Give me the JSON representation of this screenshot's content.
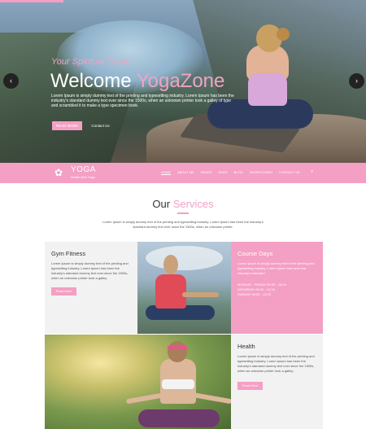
{
  "hero": {
    "subtitle": "Your Spiritual Guide",
    "title_prefix": "Welcome",
    "title_brand": "YogaZone",
    "description": "Lorem Ipsum is simply dummy text of the printing and typesetting industry. Lorem Ipsum has been the industry's standard dummy text ever since the 1500s, when an unknown printer took a galley of type and scrambled it to make a type specimen book.",
    "read_more": "READ MORE",
    "contact_us": "Contact Us",
    "prev_arrow": "‹",
    "next_arrow": "›"
  },
  "nav": {
    "logo_text": "YOGA",
    "logo_tagline": "Health And Yoga",
    "items": [
      "HOME",
      "ABOUT ME",
      "PAGES",
      "SHOP",
      "BLOG",
      "SHORTCODES",
      "CONTACT US"
    ],
    "search_icon": "search-icon",
    "accent": "#f49fc4"
  },
  "services": {
    "title_prefix": "Our",
    "title_accent": "Services",
    "description": "Lorem Ipsum is simply dummy text of the printing and typesetting industry. Lorem Ipsum has been the industry's standard dummy text ever since the 1500s, when an unknown printer.",
    "gym": {
      "title": "Gym Fitness",
      "text": "Lorem Ipsum is simply dummy text of the printing and typesetting industry. Lorem Ipsum has been the industry's standard dummy text ever since the 1500s, when an unknown printer took a galley.",
      "button": "Read More"
    },
    "course": {
      "title": "Course Days",
      "text": "Lorem Ipsum is simply dummy text of the printing and typesetting industry. Lorem Ipsum has been the industry's standard.",
      "hours": [
        "MONDAY - FRIDAY 08.00 - 16.00",
        "SATURDAY 09.00 - 13.00",
        "SUNDAY 09.00 - 13.00"
      ]
    },
    "health": {
      "title": "Health",
      "text": "Lorem Ipsum is simply dummy text of the printing and typesetting industry. Lorem Ipsum has been the industry's standard dummy text ever since the 1500s, when an unknown printer took a galley.",
      "button": "Read More"
    }
  }
}
